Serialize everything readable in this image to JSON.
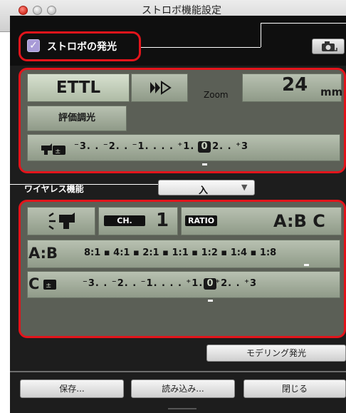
{
  "window": {
    "title": "ストロボ機能設定"
  },
  "flash_toggle": {
    "label": "ストロボの発光",
    "checked": true
  },
  "flash_settings": {
    "mode": "ETTL",
    "sync_icon": "high-speed-sync-icon",
    "zoom_label": "Zoom",
    "zoom_value": "24",
    "zoom_unit": "mm",
    "metering": "評価調光",
    "fec_scale": "⁻3. . ⁻2. . ⁻1. .  . . ⁺1. . ⁺2. . ⁺3",
    "fec_zero": "0"
  },
  "wireless": {
    "label": "ワイヤレス機能",
    "value": "入",
    "ch_label": "CH.",
    "ch_value": "1",
    "ratio_label": "RATIO",
    "ratio_value": "A:B C",
    "ab_label": "A:B",
    "ab_scale": "8:1 ▪ 4:1 ▪ 2:1 ▪ 1:1 ▪ 1:2 ▪ 1:4 ▪ 1:8",
    "c_label": "C",
    "c_scale": "⁻3. . ⁻2. . ⁻1. .  . . ⁺1. . ⁺2. . ⁺3",
    "c_zero": "0"
  },
  "buttons": {
    "modeling": "モデリング発光",
    "save": "保存...",
    "load": "読み込み...",
    "close": "閉じる"
  }
}
